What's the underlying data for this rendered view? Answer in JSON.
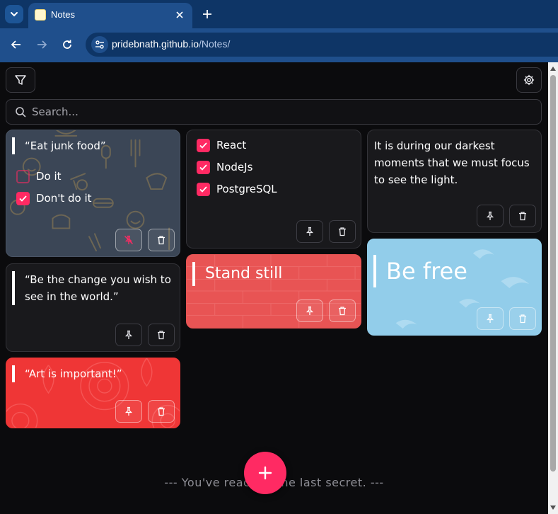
{
  "browser": {
    "tab_title": "Notes",
    "url_host": "pridebnath.github.io",
    "url_path": "/Notes/"
  },
  "app": {
    "search_placeholder": "Search...",
    "footer_text": "--- You've reached the last secret. ---",
    "accent": "#ff2a63"
  },
  "notes": [
    {
      "title": "“Eat junk food”",
      "checklist": [
        {
          "label": "Do it",
          "checked": false
        },
        {
          "label": "Don't do it",
          "checked": true
        }
      ],
      "pinned": true
    },
    {
      "title": "“Be the change you wish to see in the world.”",
      "pinned": false
    },
    {
      "title": "“Art is important!”",
      "pinned": false
    },
    {
      "checklist": [
        {
          "label": "React",
          "checked": true
        },
        {
          "label": "NodeJs",
          "checked": true
        },
        {
          "label": "PostgreSQL",
          "checked": true
        }
      ],
      "pinned": false
    },
    {
      "title": "Stand still",
      "pinned": false
    },
    {
      "body": "It is during our darkest moments that we must focus to see the light.",
      "pinned": false
    },
    {
      "title": "Be free",
      "pinned": false
    }
  ]
}
